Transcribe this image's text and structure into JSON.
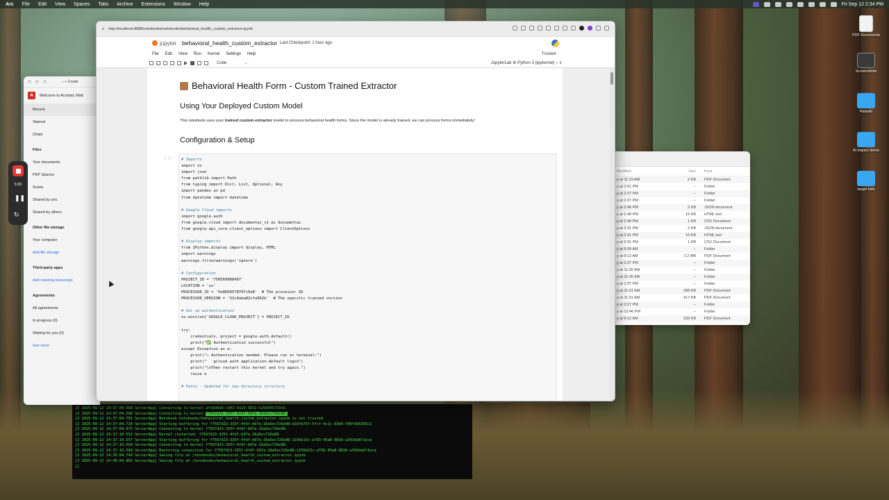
{
  "menubar": {
    "app": "Arc",
    "items": [
      "File",
      "Edit",
      "View",
      "Spaces",
      "Tabs",
      "Archive",
      "Extensions",
      "Window",
      "Help"
    ],
    "clock": "Fri Sep 12  2:34 PM"
  },
  "browser": {
    "url": "http://localhost:8888/notebooks/notebooks/behavioral_health_custom_extractor.ipynb"
  },
  "jupyter": {
    "logo_text": "jupyter",
    "notebook_name": "behavioral_health_custom_extractor",
    "checkpoint": "Last Checkpoint: 1 hour ago",
    "menu": [
      "File",
      "Edit",
      "View",
      "Run",
      "Kernel",
      "Settings",
      "Help"
    ],
    "trusted": "Trusted",
    "cell_type": "Code",
    "kernel_info": "JupyterLab  ⚙ Python 3 (ipykernel) ○ ≡",
    "cell_prompt": "[ ]:"
  },
  "notebook": {
    "title": "Behavioral Health Form - Custom Trained Extractor",
    "subtitle": "Using Your Deployed Custom Model",
    "para_pre": "This notebook uses your ",
    "para_bold": "trained custom extractor",
    "para_post": " model to process behavioral health forms. Since the model is already trained, we can process forms immediately!",
    "section": "Configuration & Setup"
  },
  "code_lines": [
    {
      "t": "# Imports",
      "c": "cm"
    },
    {
      "t": "import os",
      "c": ""
    },
    {
      "t": "import json",
      "c": ""
    },
    {
      "t": "from pathlib import Path",
      "c": ""
    },
    {
      "t": "from typing import Dict, List, Optional, Any",
      "c": ""
    },
    {
      "t": "import pandas as pd",
      "c": ""
    },
    {
      "t": "from datetime import datetime",
      "c": ""
    },
    {
      "t": "",
      "c": ""
    },
    {
      "t": "# Google Cloud imports",
      "c": "cm"
    },
    {
      "t": "import google.auth",
      "c": ""
    },
    {
      "t": "from google.cloud import documentai_v1 as documentai",
      "c": ""
    },
    {
      "t": "from google.api_core.client_options import ClientOptions",
      "c": ""
    },
    {
      "t": "",
      "c": ""
    },
    {
      "t": "# Display imports",
      "c": "cm"
    },
    {
      "t": "from IPython.display import display, HTML",
      "c": ""
    },
    {
      "t": "import warnings",
      "c": ""
    },
    {
      "t": "warnings.filterwarnings('ignore')",
      "c": ""
    },
    {
      "t": "",
      "c": ""
    },
    {
      "t": "# Configuration",
      "c": "cm"
    },
    {
      "t": "PROJECT_ID = '750569088497'",
      "c": ""
    },
    {
      "t": "LOCATION = 'us'",
      "c": ""
    },
    {
      "t": "PROCESSOR_ID = '5e8660578707c0e8'  # The processor ID",
      "c": ""
    },
    {
      "t": "PROCESSOR_VERSION = '32c4aba82cfa962b'  # The specific trained version",
      "c": ""
    },
    {
      "t": "",
      "c": ""
    },
    {
      "t": "# Set up authentication",
      "c": "cm"
    },
    {
      "t": "os.environ['GOOGLE_CLOUD_PROJECT'] = PROJECT_ID",
      "c": ""
    },
    {
      "t": "",
      "c": ""
    },
    {
      "t": "try:",
      "c": ""
    },
    {
      "t": "    credentials, project = google.auth.default()",
      "c": ""
    },
    {
      "t": "    print(\"✅ Authentication successful\")",
      "c": ""
    },
    {
      "t": "except Exception as e:",
      "c": ""
    },
    {
      "t": "    print(\"⚠ Authentication needed. Please run in terminal:\")",
      "c": ""
    },
    {
      "t": "    print(\"   gcloud auth application-default login\")",
      "c": ""
    },
    {
      "t": "    print(\"\\nThen restart this kernel and try again.\")",
      "c": ""
    },
    {
      "t": "    raise e",
      "c": ""
    },
    {
      "t": "",
      "c": ""
    },
    {
      "t": "# Paths - Updated for new directory structure",
      "c": "cm"
    }
  ],
  "acrobat": {
    "create": "Create",
    "welcome": "Welcome to Acrobat, Matt",
    "items": [
      "Recent",
      "Starred",
      "Chats"
    ],
    "files_title": "Files",
    "files": [
      "Your documents",
      "PDF Spaces",
      "Scans",
      "Shared by you",
      "Shared by others"
    ],
    "other_title": "Other file storage",
    "other": [
      "Your computer"
    ],
    "add_storage": "Add file storage",
    "third_title": "Third-party apps",
    "add_meeting": "Add meeting transcripts",
    "agreements_title": "Agreements",
    "agreements": [
      "All agreements",
      "In progress (0)",
      "Waiting for you (0)"
    ],
    "see_more": "See more"
  },
  "recorder": {
    "time": "5:00"
  },
  "terminal": {
    "lines": [
      "[I 2025-09-12 14:37:04.568 ServerApp] Connecting to kernel afe836b8-c843-4a19-9832-b26d64575bd1.",
      "[I 2025-09-12 14:37:04.588 ServerApp] Connecting to kernel ",
      "[I 2025-09-12 14:37:04.701 ServerApp] Notebook notebooks/behavioral_health_custom_extractor.ipynb is not trusted",
      "[I 2025-09-12 14:37:04.720 ServerApp] Starting buffering for f7567d23-335f-4fdf-b97a-16a5ec726e88:d16fd75f-5fcf-4c1c-93b4-f00f3d5356c2",
      "[I 2025-09-12 14:37:04.975 ServerApp] Connecting to kernel f7567d23-335f-4fdf-b97a-16a5ec726e88.",
      "[I 2025-09-12 14:37:10.552 ServerApp] Kernel restarted: f7567d23-335f-4fdf-b97a-16a5ec726e88",
      "[I 2025-09-12 14:37:10.557 ServerApp] Starting buffering for f7567d23-335f-4fdf-b97a-16a5ec726e88:1156d13c-a793-45a8-983d-a393da6f1eca",
      "[I 2025-09-12 14:37:10.568 ServerApp] Connecting to kernel f7567d23-335f-4fdf-b97a-16a5ec726e88.",
      "[I 2025-09-12 14:37:10.568 ServerApp] Restoring connection for f7567d23-335f-4fdf-b97a-16a5ec726e88:1156d13c-a793-45a8-983d-a393da6f1eca",
      "[I 2025-09-12 14:39:04.744 ServerApp] Saving file at /notebooks/behavioral_health_custom_extractor.ipynb",
      "[I 2025-09-12 14:49:04.802 ServerApp] Saving file at /notebooks/behavioral_health_custom_extractor.ipynb",
      "[]"
    ],
    "highlight": "f7567d23-335f-4fdf-b97a-16a5ec726e88."
  },
  "finder": {
    "headers": [
      "Modified",
      "Size",
      "Kind"
    ],
    "rows": [
      [
        "y at 11:29 AM",
        "2 KB",
        "PDF Document"
      ],
      [
        "y at 2:01 PM",
        "--",
        "Folder"
      ],
      [
        "y at 2:27 PM",
        "--",
        "Folder"
      ],
      [
        "y at 2:37 PM",
        "--",
        "Folder"
      ],
      [
        "y at 2:48 PM",
        "2 KB",
        "JSON document"
      ],
      [
        "y at 2:48 PM",
        "16 KB",
        "HTML text"
      ],
      [
        "y at 2:48 PM",
        "1 KB",
        "CSV Document"
      ],
      [
        "y at 2:31 PM",
        "2 KB",
        "JSON document"
      ],
      [
        "y at 2:31 PM",
        "16 KB",
        "HTML text"
      ],
      [
        "y at 2:31 PM",
        "1 KB",
        "CSV Document"
      ],
      [
        "y at 9:39 AM",
        "--",
        "Folder"
      ],
      [
        "y at 9:12 AM",
        "2.2 MB",
        "PDF Document"
      ],
      [
        "y at 2:27 PM",
        "--",
        "Folder"
      ],
      [
        "y at 11:36 AM",
        "--",
        "Folder"
      ],
      [
        "y at 11:36 AM",
        "--",
        "Folder"
      ],
      [
        "y at 1:07 PM",
        "--",
        "Folder"
      ],
      [
        "y at 11:31 AM",
        "298 KB",
        "PDF Document"
      ],
      [
        "y at 11:31 AM",
        "417 KB",
        "PDF Document"
      ],
      [
        "y at 2:27 PM",
        "--",
        "Folder"
      ],
      [
        "y at 12:46 PM",
        "--",
        "Folder"
      ],
      [
        "y at 9:12 AM",
        "233 KB",
        "PDF Document"
      ]
    ]
  },
  "desktop": {
    "icons": [
      "PDF Documents",
      "Screenshots",
      "Palantir",
      "AI impact demo",
      "target lists"
    ]
  }
}
